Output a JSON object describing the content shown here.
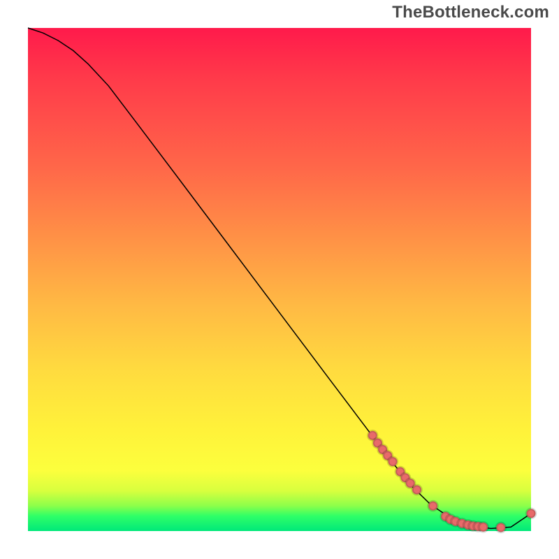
{
  "watermark": "TheBottleneck.com",
  "chart_data": {
    "type": "line",
    "title": "",
    "xlabel": "",
    "ylabel": "",
    "xlim": [
      0,
      100
    ],
    "ylim": [
      0,
      100
    ],
    "grid": false,
    "legend": false,
    "background_gradient": {
      "direction": "vertical",
      "stops": [
        {
          "pos": 0.0,
          "color": "#ff1a4b"
        },
        {
          "pos": 0.1,
          "color": "#ff3a4a"
        },
        {
          "pos": 0.28,
          "color": "#ff6849"
        },
        {
          "pos": 0.42,
          "color": "#ff9246"
        },
        {
          "pos": 0.55,
          "color": "#ffb944"
        },
        {
          "pos": 0.68,
          "color": "#ffdb3f"
        },
        {
          "pos": 0.8,
          "color": "#fff23a"
        },
        {
          "pos": 0.88,
          "color": "#fcff3d"
        },
        {
          "pos": 0.92,
          "color": "#d8ff3e"
        },
        {
          "pos": 0.95,
          "color": "#8cff4a"
        },
        {
          "pos": 0.97,
          "color": "#2fff67"
        },
        {
          "pos": 1.0,
          "color": "#00e87a"
        }
      ]
    },
    "series": [
      {
        "name": "curve",
        "type": "line",
        "color": "#000000",
        "x": [
          0,
          3,
          6,
          9,
          12,
          16,
          22,
          30,
          40,
          50,
          60,
          68,
          72,
          76,
          80,
          84,
          88,
          92,
          96,
          100
        ],
        "y": [
          100,
          99,
          97.5,
          95.5,
          92.8,
          88.5,
          80.6,
          70,
          56.7,
          43.4,
          30.1,
          19.5,
          14.2,
          9.2,
          5.3,
          2.6,
          1.1,
          0.5,
          0.8,
          3.5
        ]
      },
      {
        "name": "points",
        "type": "scatter",
        "color": "#e86a6a",
        "x": [
          68.5,
          69.5,
          70.5,
          71.5,
          72.5,
          74.0,
          75.0,
          76.0,
          77.3,
          80.5,
          83.0,
          84.0,
          85.0,
          86.3,
          87.5,
          88.5,
          89.5,
          90.5,
          94.0,
          100.0
        ],
        "y": [
          19.0,
          17.5,
          16.2,
          15.0,
          13.8,
          11.8,
          10.6,
          9.5,
          8.2,
          5.0,
          2.9,
          2.3,
          1.9,
          1.5,
          1.2,
          1.0,
          0.9,
          0.8,
          0.7,
          3.5
        ]
      }
    ]
  }
}
